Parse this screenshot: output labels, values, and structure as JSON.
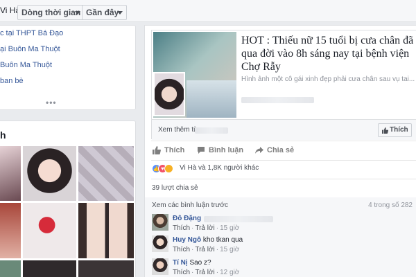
{
  "topbar": {
    "name": "Vi Hà",
    "dropdown_timeline": "Dòng thời gian",
    "dropdown_recent": "Gần đây"
  },
  "intro": {
    "rows": [
      "c tại THPT Bá Đạo",
      "ại Buôn Ma Thuột",
      "Buôn Ma Thuột",
      "ban bè"
    ],
    "more": "•••"
  },
  "photos": {
    "title": "h"
  },
  "post": {
    "headline": "HOT : Thiếu nữ 15 tuổi bị cưa chân đã qua đời vào 8h sáng nay tại bệnh viện Chợ Rẫy",
    "description": "Hình ảnh một cô gái xinh đẹp phải cưa chân sau vụ tai...",
    "see_more": "Xem thêm từ",
    "like_page": "Thích",
    "actions": {
      "like": "Thích",
      "comment": "Bình luận",
      "share": "Chia sẻ"
    },
    "reactions_text": "Vi Hà và 1,8K người khác",
    "shares_text": "39 lượt chia sẻ"
  },
  "comments": {
    "view_previous": "Xem các bình luận trước",
    "count": "4 trong số 282",
    "like_label": "Thích",
    "reply_label": "Trả lời",
    "items": [
      {
        "name": "Đô Đặng",
        "text": "",
        "time": "15 giờ"
      },
      {
        "name": "Huy Ngô",
        "text": "kho tkan qua",
        "time": "15 giờ"
      },
      {
        "name": "Tí Nị",
        "text": "Sao z?",
        "time": "12 giờ"
      }
    ]
  }
}
